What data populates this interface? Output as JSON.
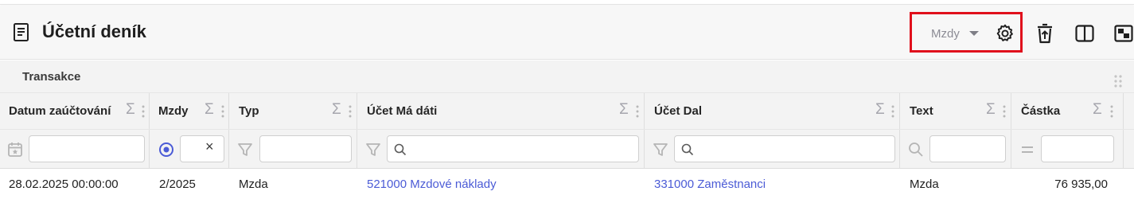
{
  "page": {
    "title": "Účetní deník",
    "preset_select": "Mzdy",
    "group_label": "Transakce"
  },
  "columns": [
    {
      "key": "datum",
      "label": "Datum zaúčtování",
      "sigma": "Σ"
    },
    {
      "key": "mzdy",
      "label": "Mzdy",
      "sigma": "Σ"
    },
    {
      "key": "typ",
      "label": "Typ",
      "sigma": "Σ"
    },
    {
      "key": "ucet_ma_dati",
      "label": "Účet Má dáti",
      "sigma": "Σ"
    },
    {
      "key": "ucet_dal",
      "label": "Účet Dal",
      "sigma": "Σ"
    },
    {
      "key": "text",
      "label": "Text",
      "sigma": "Σ"
    },
    {
      "key": "castka",
      "label": "Částka",
      "sigma": "Σ"
    }
  ],
  "filters": {
    "datum": {
      "value": "",
      "icon": "calendar-icon"
    },
    "mzdy": {
      "value": "",
      "icon": "radio-target-icon",
      "clear": "×"
    },
    "typ": {
      "value": "",
      "icon": "funnel-icon"
    },
    "ucet_ma_dati": {
      "value": "",
      "icon": "funnel-icon"
    },
    "ucet_dal": {
      "value": "",
      "icon": "funnel-icon"
    },
    "text": {
      "value": "",
      "icon": "search-icon"
    },
    "castka": {
      "value": "",
      "icon": "equals-icon"
    }
  },
  "rows": [
    {
      "datum": "28.02.2025 00:00:00",
      "mzdy": "2/2025",
      "typ": "Mzda",
      "ucet_ma_dati": "521000 Mzdové náklady",
      "ucet_dal": "331000 Zaměstnanci",
      "text": "Mzda",
      "castka": "76 935,00"
    }
  ],
  "toolbar_icons": [
    "gear-icon",
    "export-trash-icon",
    "split-view-icon",
    "expand-icon"
  ],
  "colors": {
    "highlight_border": "#e0101c",
    "link": "#4b5bd6",
    "header_bg": "#f7f7f7",
    "grid_bg": "#f3f3f3"
  }
}
